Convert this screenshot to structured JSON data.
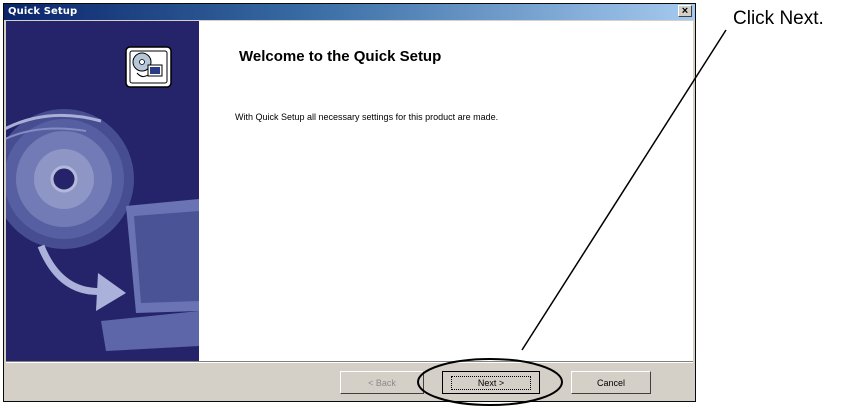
{
  "window": {
    "title": "Quick Setup",
    "close_glyph": "×"
  },
  "content": {
    "heading": "Welcome to the Quick Setup",
    "body": "With Quick Setup all necessary settings for this product are made."
  },
  "buttons": {
    "back": "< Back",
    "next": "Next >",
    "cancel": "Cancel"
  },
  "annotation": {
    "text": "Click Next."
  },
  "icons": {
    "header_icon": "disc-to-computer-icon",
    "close": "close-icon"
  },
  "colors": {
    "side_panel": "#25246a",
    "title_bar_start": "#0a246a",
    "title_bar_end": "#a6caf0",
    "dialog_bg": "#d4d0c8"
  }
}
